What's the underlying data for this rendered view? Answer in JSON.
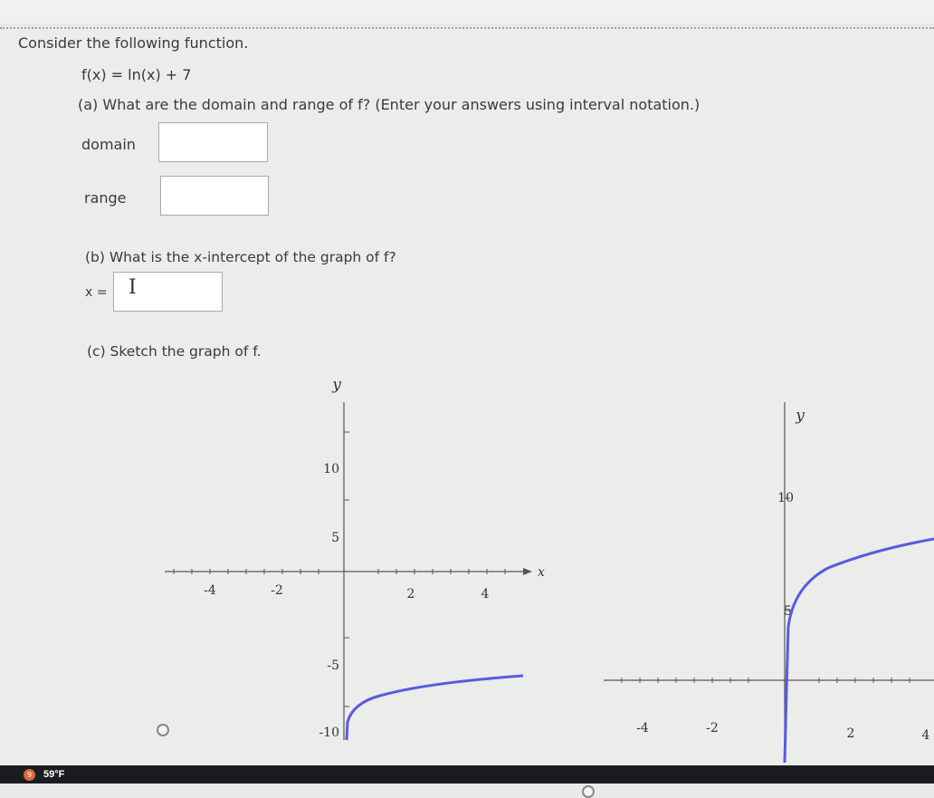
{
  "question": {
    "prompt": "Consider the following function.",
    "function": "f(x) = ln(x) + 7",
    "part_a": "(a) What are the domain and range of f? (Enter your answers using interval notation.)",
    "domain_label": "domain",
    "range_label": "range",
    "domain_value": "",
    "range_value": "",
    "part_b": "(b) What is the x-intercept of the graph of f?",
    "x_label": "x =",
    "x_value": "",
    "part_c": "(c) Sketch the graph of f."
  },
  "graph_left": {
    "y_label": "y",
    "x_label": "x",
    "x_ticks": [
      "-4",
      "-2",
      "2",
      "4"
    ],
    "y_ticks": [
      "10",
      "5",
      "-5",
      "-10"
    ],
    "curve_color": "#5a5ae0"
  },
  "graph_right": {
    "y_label": "y",
    "x_ticks": [
      "-4",
      "-2",
      "2",
      "4"
    ],
    "y_ticks": [
      "10",
      "5"
    ],
    "curve_color": "#5a5ae0"
  },
  "status_bar": {
    "weather_icon": "weather-alert-icon",
    "badge": "9",
    "temperature": "59°F"
  }
}
